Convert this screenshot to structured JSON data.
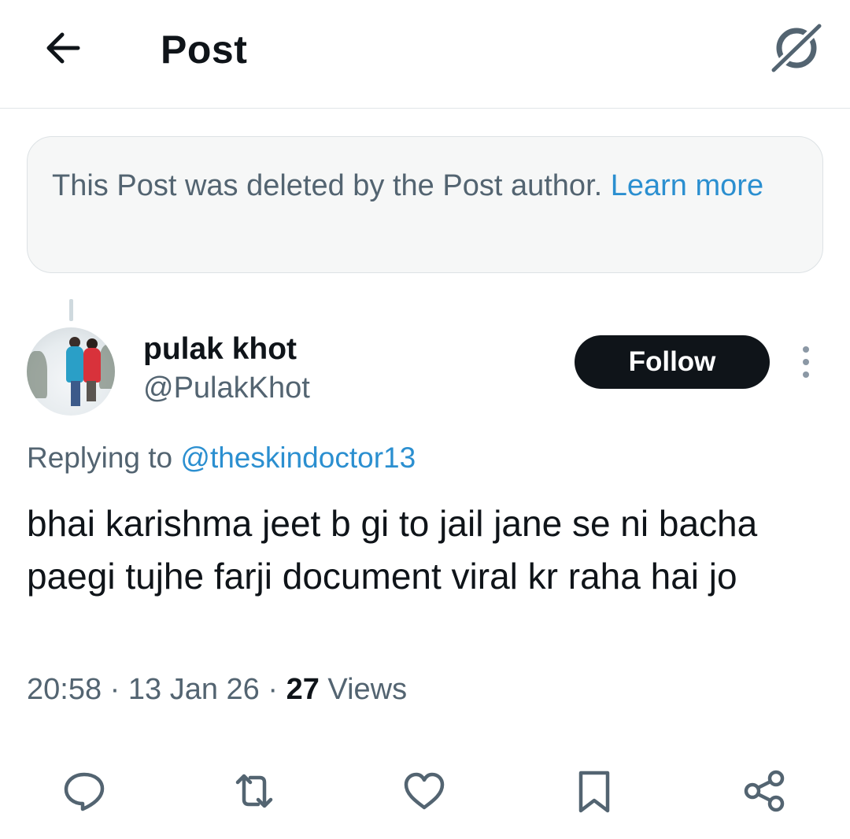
{
  "header": {
    "title": "Post",
    "back_icon": "arrow-left-icon",
    "grok_icon": "grok-icon"
  },
  "notice": {
    "text": "This Post was deleted by the Post author.",
    "link": "Learn more"
  },
  "post": {
    "author_name": "pulak khot",
    "author_handle": "@PulakKhot",
    "follow_label": "Follow",
    "replying_prefix": "Replying to",
    "replying_handle": "@theskindoctor13",
    "text": "bhai karishma jeet b gi to jail jane se ni bacha paegi tujhe farji document viral kr raha hai jo",
    "time": "20:58",
    "date": "13 Jan 26",
    "views_count": "27",
    "views_label": "Views",
    "separator": "·"
  },
  "actions": {
    "reply_icon": "reply-icon",
    "repost_icon": "repost-icon",
    "like_icon": "heart-icon",
    "bookmark_icon": "bookmark-icon",
    "share_icon": "share-icon"
  },
  "colors": {
    "text_primary": "#0f1419",
    "text_secondary": "#536471",
    "link": "#2b8fd0",
    "follow_bg": "#0f1419",
    "notice_bg": "#f6f7f7"
  }
}
